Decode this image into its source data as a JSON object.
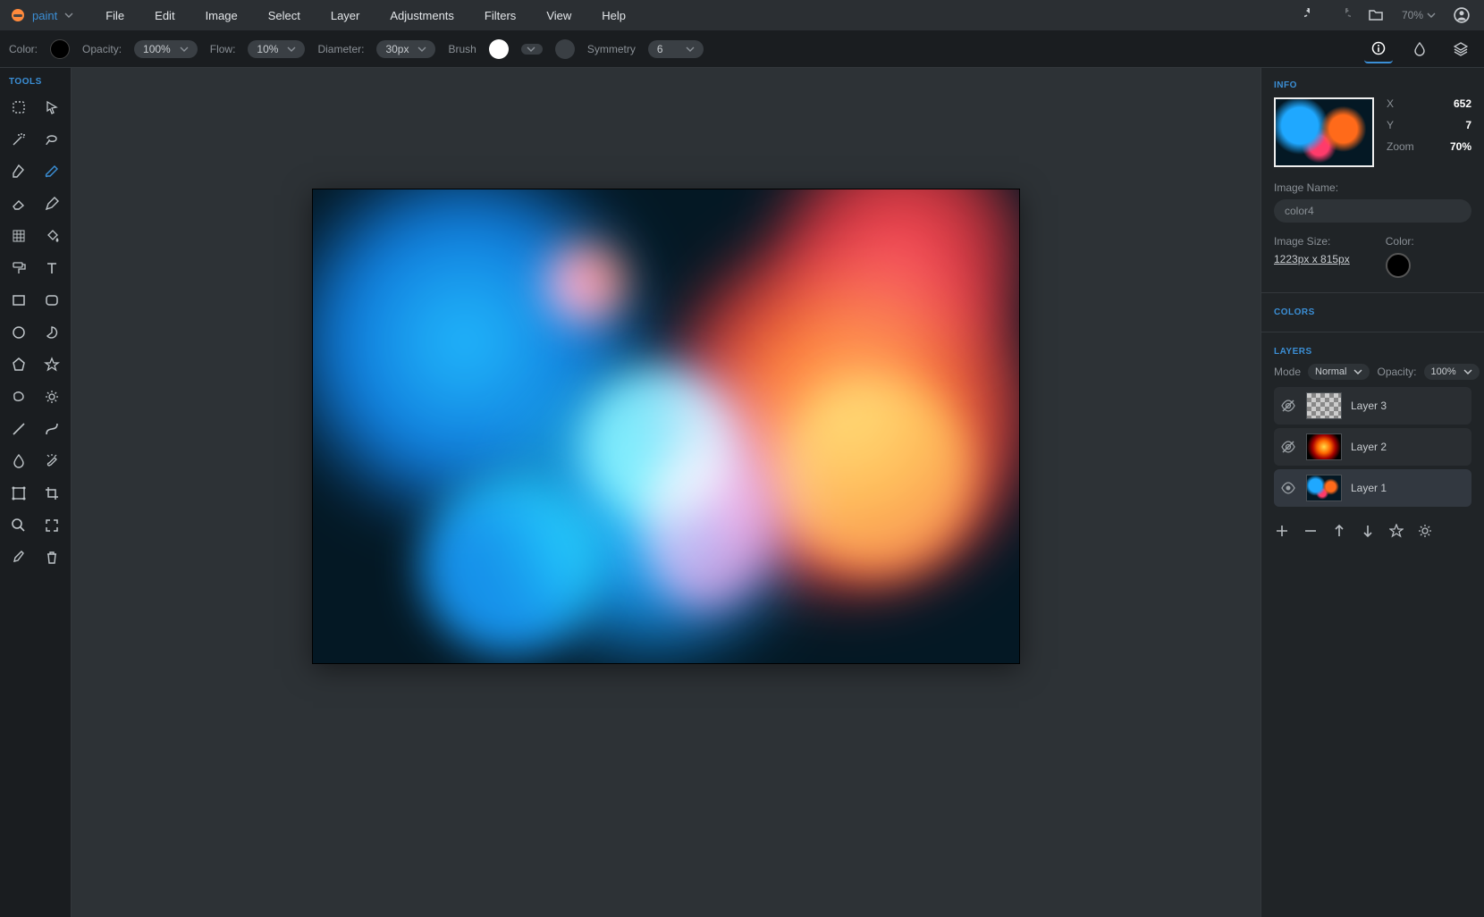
{
  "app": {
    "name": "paint"
  },
  "menu": {
    "file": "File",
    "edit": "Edit",
    "image": "Image",
    "select": "Select",
    "layer": "Layer",
    "adjustments": "Adjustments",
    "filters": "Filters",
    "view": "View",
    "help": "Help"
  },
  "toolbar_right": {
    "zoom": "70%"
  },
  "options": {
    "color_label": "Color:",
    "opacity_label": "Opacity:",
    "opacity_value": "100%",
    "flow_label": "Flow:",
    "flow_value": "10%",
    "diameter_label": "Diameter:",
    "diameter_value": "30px",
    "brush_label": "Brush",
    "symmetry_label": "Symmetry",
    "symmetry_value": "6"
  },
  "tools_title": "TOOLS",
  "tools": [
    "select-rect",
    "move",
    "magic-wand",
    "lasso",
    "pen",
    "brush",
    "eraser",
    "pencil",
    "pattern",
    "bucket",
    "paint-roller",
    "text",
    "rect-shape",
    "rounded-rect",
    "ellipse",
    "pie",
    "polygon",
    "star",
    "blob",
    "gear",
    "line",
    "curve",
    "blur",
    "smudge",
    "transform",
    "crop",
    "zoom",
    "fullscreen",
    "eyedropper",
    "trash"
  ],
  "info": {
    "title": "INFO",
    "x_label": "X",
    "x_value": "652",
    "y_label": "Y",
    "y_value": "7",
    "zoom_label": "Zoom",
    "zoom_value": "70%",
    "image_name_label": "Image Name:",
    "image_name_value": "color4",
    "image_size_label": "Image Size:",
    "image_size_value": "1223px x 815px",
    "color_label": "Color:"
  },
  "colors": {
    "title": "COLORS"
  },
  "layers": {
    "title": "LAYERS",
    "mode_label": "Mode",
    "mode_value": "Normal",
    "opacity_label": "Opacity:",
    "opacity_value": "100%",
    "items": [
      {
        "name": "Layer 3",
        "visible": false,
        "thumb": "checker"
      },
      {
        "name": "Layer 2",
        "visible": false,
        "thumb": "grad"
      },
      {
        "name": "Layer 1",
        "visible": true,
        "thumb": "ink",
        "selected": true
      }
    ]
  }
}
